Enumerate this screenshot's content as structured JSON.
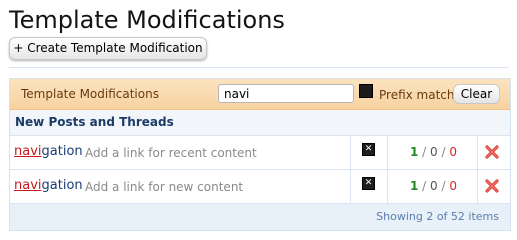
{
  "page": {
    "title": "Template Modifications",
    "create_button": "+ Create Template Modification"
  },
  "filter": {
    "label": "Template Modifications",
    "value": "navi",
    "prefix_match_label": "Prefix match",
    "prefix_match_checked": true,
    "clear_label": "Clear"
  },
  "group": {
    "title": "New Posts and Threads"
  },
  "rows": [
    {
      "name_highlight": "navi",
      "name_rest": "gation",
      "description": "Add a link for recent content",
      "enabled": true,
      "counts": {
        "applied": "1",
        "sep1": " / ",
        "not_applied": "0",
        "sep2": " / ",
        "failed": "0"
      }
    },
    {
      "name_highlight": "navi",
      "name_rest": "gation",
      "description": "Add a link for new content",
      "enabled": true,
      "counts": {
        "applied": "1",
        "sep1": " / ",
        "not_applied": "0",
        "sep2": " / ",
        "failed": "0"
      }
    }
  ],
  "footer": {
    "summary": "Showing 2 of 52 items"
  },
  "colors": {
    "highlight": "#c8191e",
    "applied": "#1f8a1f",
    "failed": "#d22222",
    "delete": "#e0403a"
  },
  "icons": {
    "delete": "delete-icon",
    "toggle": "checkbox-icon"
  }
}
